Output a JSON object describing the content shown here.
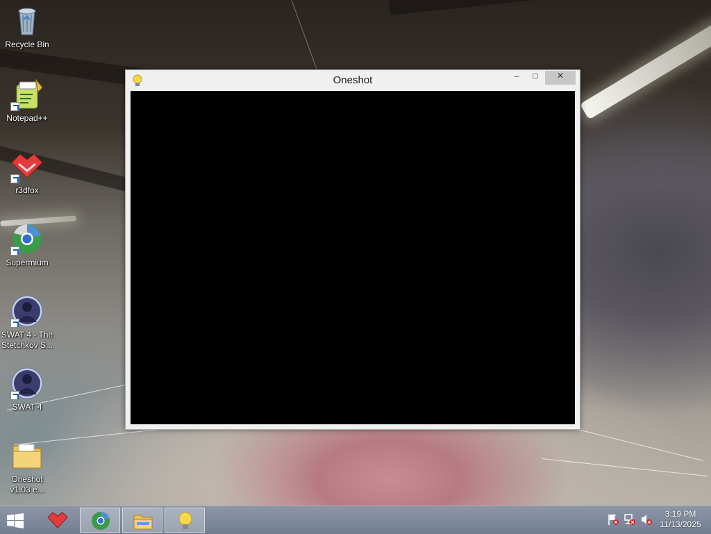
{
  "desktop": {
    "icons": [
      {
        "label": "Recycle Bin",
        "icon": "recycle-bin-icon",
        "shortcut": false
      },
      {
        "label": "Notepad++",
        "icon": "notepad-plus-plus-icon",
        "shortcut": true
      },
      {
        "label": "r3dfox",
        "icon": "r3dfox-icon",
        "shortcut": true
      },
      {
        "label": "Supermium",
        "icon": "supermium-icon",
        "shortcut": true
      },
      {
        "label": "SWAT 4 - The Stetchkov S...",
        "icon": "swat4-icon",
        "shortcut": true
      },
      {
        "label": "SWAT 4",
        "icon": "swat4-icon",
        "shortcut": true
      },
      {
        "label": "Oneshot v1.03 e...",
        "icon": "folder-icon",
        "shortcut": false
      }
    ]
  },
  "window": {
    "title": "Oneshot",
    "icon": "lightbulb-icon",
    "minimize_glyph": "–",
    "maximize_glyph": "□",
    "close_glyph": "✕",
    "content_color": "#000000"
  },
  "taskbar": {
    "start_icon": "windows-logo-icon",
    "buttons": [
      {
        "name": "r3dfox",
        "icon": "r3dfox-icon",
        "active": false
      },
      {
        "name": "Supermium",
        "icon": "supermium-icon",
        "active": true
      },
      {
        "name": "File Explorer",
        "icon": "file-explorer-icon",
        "active": true
      },
      {
        "name": "Oneshot",
        "icon": "lightbulb-icon",
        "active": true
      }
    ],
    "tray_icons": [
      "action-center-flag-icon",
      "network-icon",
      "volume-muted-icon"
    ],
    "clock": {
      "time": "3:19 PM",
      "date": "11/13/2025"
    }
  },
  "colors": {
    "taskbar": "#7d88a0",
    "window_frame": "#f0f0f0",
    "close_button": "#c7c7c7"
  }
}
